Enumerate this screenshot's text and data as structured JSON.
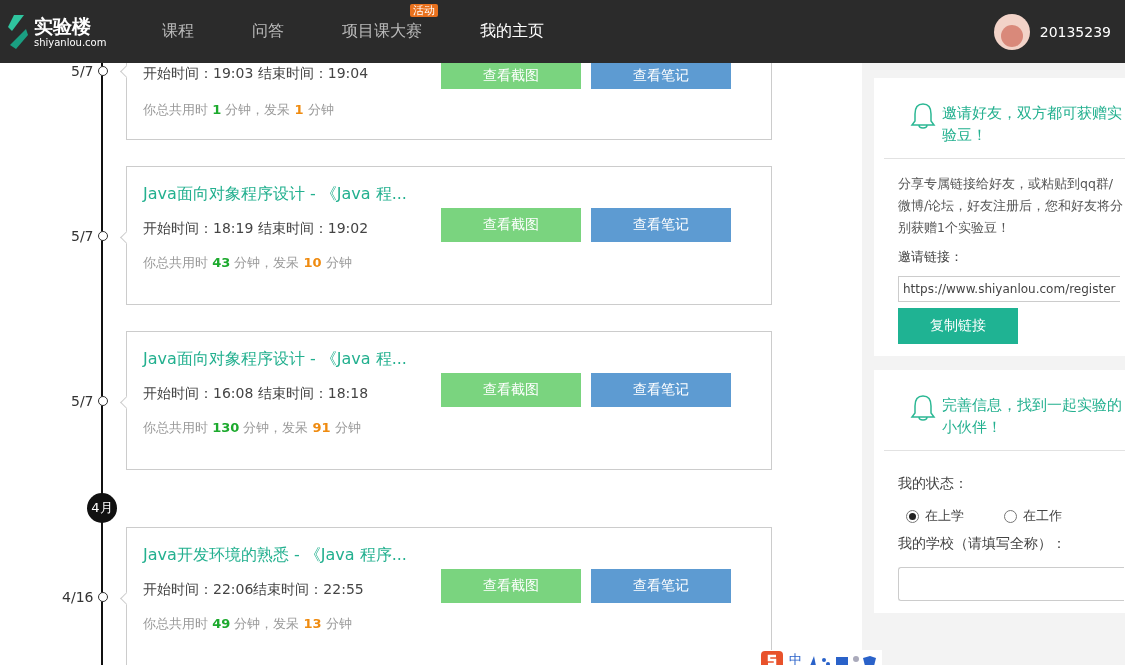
{
  "nav": {
    "logo": {
      "name": "实验楼",
      "domain": "shiyanlou.com"
    },
    "items": [
      {
        "label": "课程",
        "selected": false
      },
      {
        "label": "问答",
        "selected": false
      },
      {
        "label": "项目课大赛",
        "selected": false,
        "badge": "活动"
      },
      {
        "label": "我的主页",
        "selected": true
      }
    ],
    "user": {
      "name": "20135239"
    }
  },
  "timeline": [
    {
      "kind": "entry",
      "date": "5/7",
      "time": "开始时间：19:03 结束时间：19:04",
      "stats": "你总共用时 **1** 分钟，发呆 **1** 分钟",
      "buttons": [
        "查看截图",
        "查看笔记"
      ]
    },
    {
      "kind": "entry",
      "date": "5/7",
      "title": "Java面向对象程序设计 - 《Java 程...",
      "time": "开始时间：18:19 结束时间：19:02",
      "stats": "你总共用时 **43** 分钟，发呆 **10** 分钟",
      "buttons": [
        "查看截图",
        "查看笔记"
      ]
    },
    {
      "kind": "entry",
      "date": "5/7",
      "title": "Java面向对象程序设计 - 《Java 程...",
      "time": "开始时间：16:08 结束时间：18:18",
      "stats": "你总共用时 **130** 分钟，发呆 **91** 分钟",
      "buttons": [
        "查看截图",
        "查看笔记"
      ]
    },
    {
      "kind": "month",
      "label": "4月"
    },
    {
      "kind": "entry",
      "date": "4/16",
      "title": "Java开发环境的熟悉 - 《Java 程序...",
      "time": "开始时间：22:06结束时间：22:55",
      "stats": "你总共用时 **49** 分钟，发呆 **13** 分钟",
      "buttons": [
        "查看截图",
        "查看笔记"
      ]
    }
  ],
  "invite": {
    "title": "邀请好友，双方都可获赠实验豆！",
    "text": "分享专属链接给好友，或粘贴到qq群/微博/论坛，好友注册后，您和好友将分别获赠1个实验豆！",
    "link_label": "邀请链接：",
    "link": "https://www.shiyanlou.com/register",
    "button": "复制链接"
  },
  "profile": {
    "title": "完善信息，找到一起实验的小伙伴！",
    "status_label": "我的状态：",
    "options": [
      {
        "label": "在上学",
        "selected": true
      },
      {
        "label": "在工作",
        "selected": false
      }
    ],
    "school_label": "我的学校（请填写全称）："
  },
  "ime": {
    "mode": "中"
  }
}
